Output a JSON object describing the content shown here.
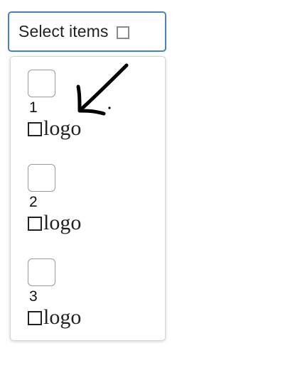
{
  "select": {
    "label": "Select items",
    "icon": "checkbox-icon"
  },
  "dropdown": {
    "options": [
      {
        "number": "1",
        "logo_text": "logo",
        "checked": false
      },
      {
        "number": "2",
        "logo_text": "logo",
        "checked": false
      },
      {
        "number": "3",
        "logo_text": "logo",
        "checked": false
      }
    ]
  },
  "annotation": {
    "icon": "hand-drawn-arrow-icon",
    "color": "#000000"
  },
  "colors": {
    "accent_border": "#4a7fc0",
    "text": "#222222"
  }
}
